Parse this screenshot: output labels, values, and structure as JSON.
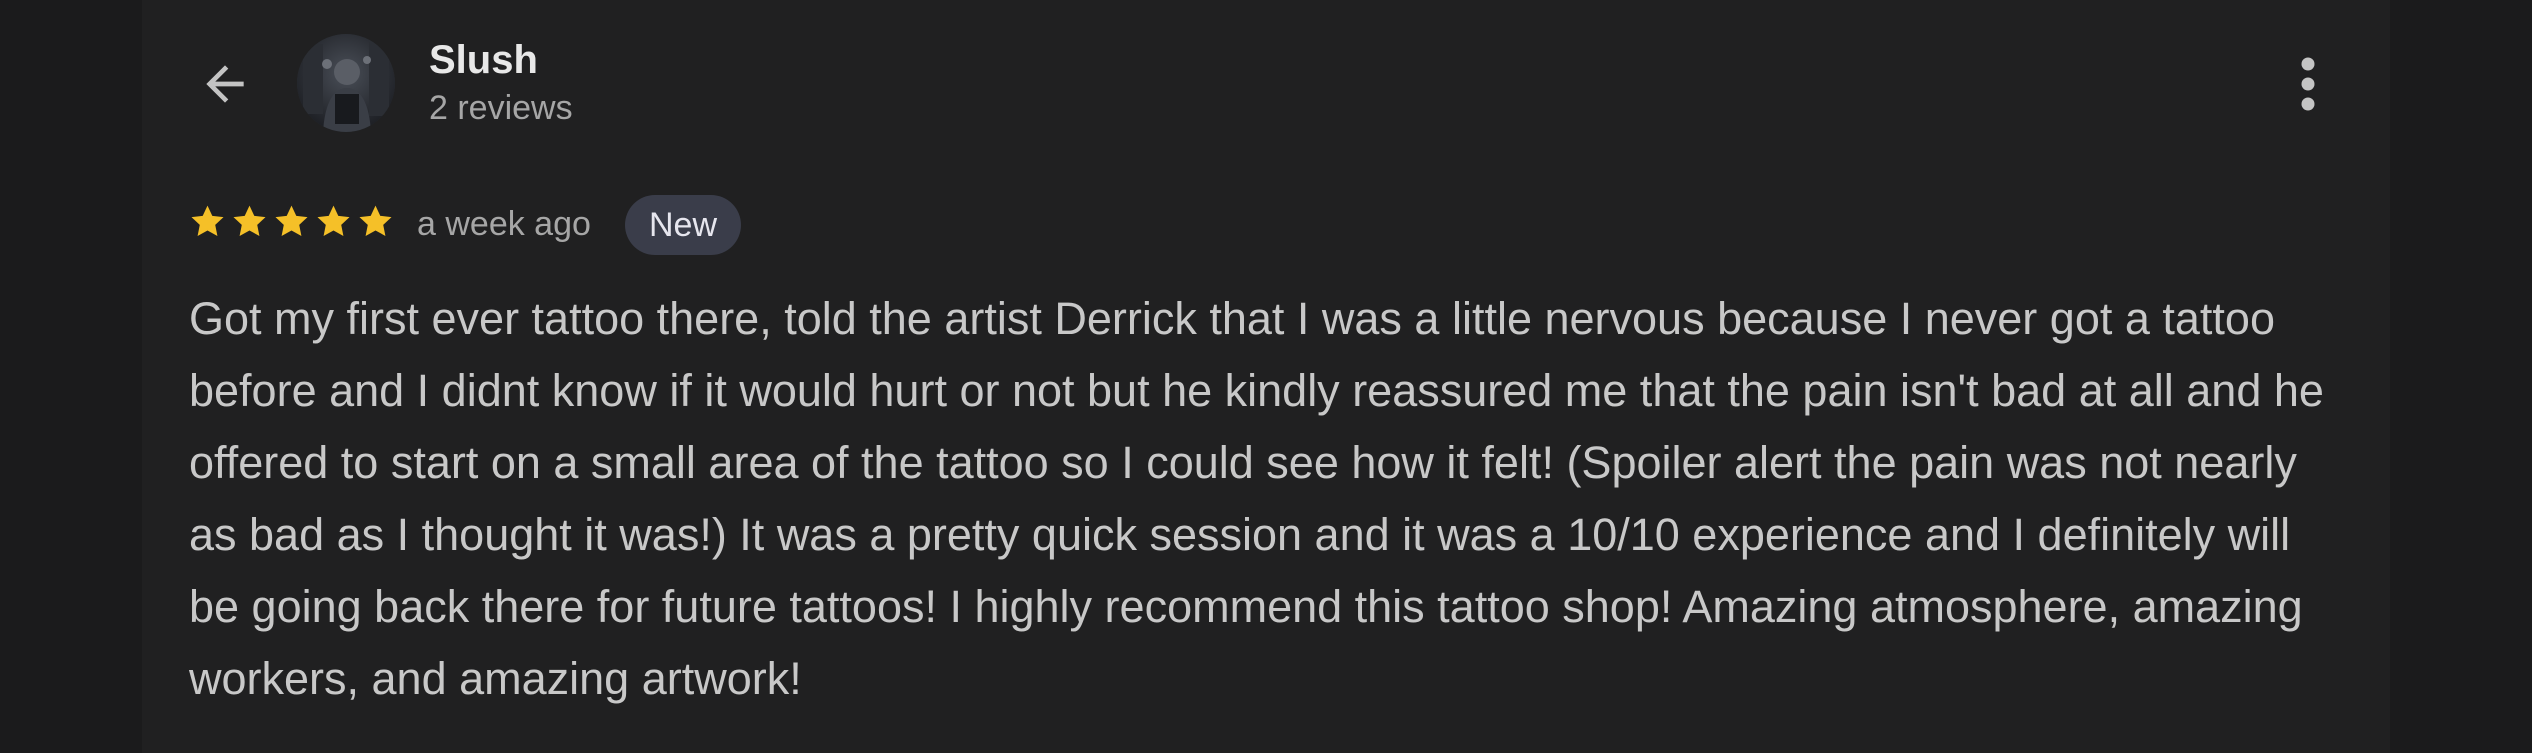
{
  "header": {
    "back_icon": "arrow-left-icon",
    "reviewer_name": "Slush",
    "review_count": "2 reviews",
    "more_icon": "more-vertical-icon"
  },
  "review": {
    "rating": 5,
    "rating_max": 5,
    "star_color": "#f5c028",
    "time_ago": "a week ago",
    "badge": "New",
    "text": "Got my first ever tattoo there, told the artist Derrick that I was a little nervous because I never got a tattoo before and I didnt know if it would hurt or not but he kindly reassured me that the pain isn't bad at all and he offered to start on a small area of the tattoo so I could see how it felt! (Spoiler alert the pain was not nearly as bad as I thought it was!) It was a pretty quick session and it was a 10/10 experience and I definitely will be going back there for future tattoos! I highly recommend this tattoo shop! Amazing atmosphere, amazing workers, and amazing artwork!"
  },
  "colors": {
    "background": "#202021",
    "text": "#c8c8c8",
    "muted_text": "#a6a6a6",
    "badge_bg": "#3a3d4a"
  }
}
